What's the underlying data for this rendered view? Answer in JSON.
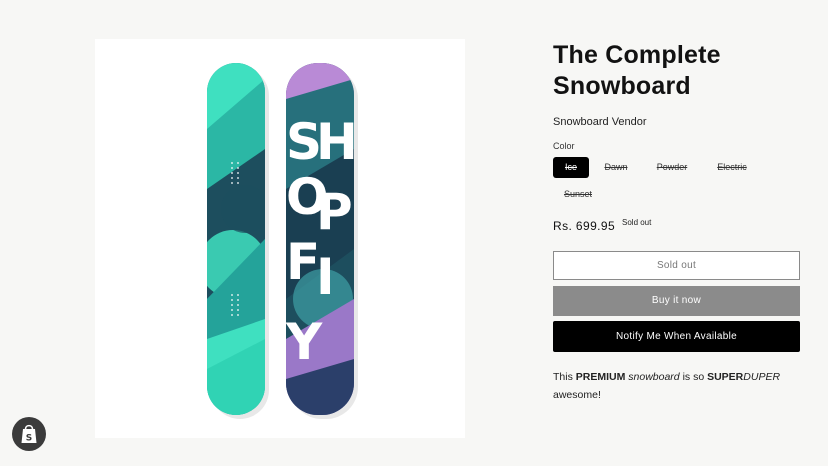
{
  "product": {
    "title_line1": "The Complete",
    "title_line2": "Snowboard",
    "vendor": "Snowboard Vendor",
    "color_label": "Color",
    "color_options": [
      "Ice",
      "Dawn",
      "Powder",
      "Electric",
      "Sunset"
    ],
    "selected_color": "Ice",
    "price": "Rs. 699.95",
    "sold_out_badge": "Sold out",
    "board_graphic_text": "SHOPIFY"
  },
  "buttons": {
    "sold_out": "Sold out",
    "buy_now": "Buy it now",
    "notify": "Notify Me When Available"
  },
  "description": {
    "part1": "This ",
    "bold1": "PREMIUM",
    "part2": " ",
    "italic1": "snowboard",
    "part3": " is so ",
    "bold2": "SUPER",
    "italic2": "DUPER",
    "line2": "awesome!"
  },
  "colors": {
    "teal_light": "#3fe0c0",
    "teal_dark": "#1d4e5e",
    "purple": "#b98ad6",
    "black": "#000000"
  }
}
